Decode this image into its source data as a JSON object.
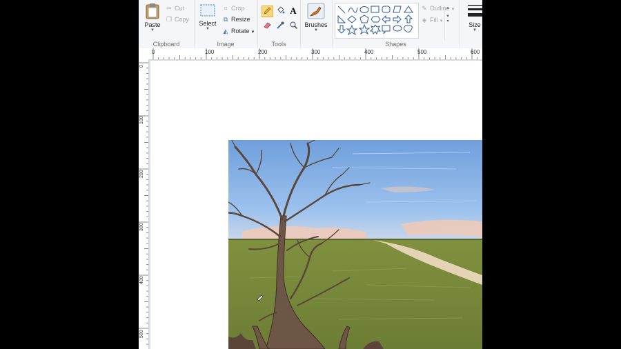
{
  "clipboard": {
    "paste_label": "Paste",
    "cut_label": "Cut",
    "copy_label": "Copy",
    "group_label": "Clipboard"
  },
  "image": {
    "select_label": "Select",
    "crop_label": "Crop",
    "resize_label": "Resize",
    "rotate_label": "Rotate",
    "group_label": "Image"
  },
  "tools": {
    "group_label": "Tools",
    "items": [
      "pencil-icon",
      "fill-icon",
      "text-icon",
      "eraser-icon",
      "color-picker-icon",
      "magnifier-icon"
    ],
    "selected": "pencil-icon"
  },
  "brushes": {
    "label": "Brushes"
  },
  "shapes": {
    "group_label": "Shapes",
    "outline_label": "Outline",
    "fill_label": "Fill"
  },
  "size": {
    "label": "Size"
  },
  "ruler": {
    "horizontal_ticks": [
      "0",
      "100",
      "200",
      "300",
      "400",
      "500",
      "600"
    ],
    "vertical_ticks": [
      "0",
      "100",
      "200",
      "300",
      "400",
      "500"
    ]
  },
  "colors": {
    "sky": "#7fb0e6",
    "grass": "#7d8f3f",
    "trunk": "#6e5647",
    "selected_tool": "#fdd77d"
  }
}
